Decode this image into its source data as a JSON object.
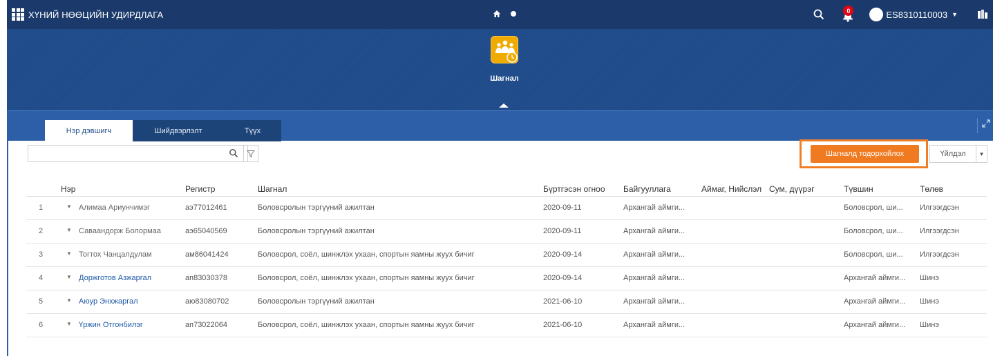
{
  "shell": {
    "title": "ХҮНИЙ НӨӨЦИЙН УДИРДЛАГА",
    "notifications_count": "0",
    "user_id": "ES8310110003",
    "user_caret": "▼"
  },
  "app": {
    "label": "Шагнал",
    "tile_color": "#f0ab00"
  },
  "tabs": [
    {
      "label": "Нэр дэвшигч"
    },
    {
      "label": "Шийдвэрлэлт"
    },
    {
      "label": "Түүх"
    }
  ],
  "toolbar": {
    "search_placeholder": "",
    "primary_label": "Шагналд тодорхойлох",
    "action_label": "Үйлдэл",
    "action_caret": "▼",
    "accent_color": "#f07a20"
  },
  "table": {
    "headers": [
      "Нэр",
      "Регистр",
      "Шагнал",
      "Бүртгэсэн огноо",
      "Байгууллага",
      "Аймаг, Нийслэл",
      "Сум, дүүрэг",
      "Түвшин",
      "Төлөв"
    ],
    "rows": [
      {
        "index": "1",
        "name": "Алимаа Ариунчимэг",
        "register": "аэ77012461",
        "award": "Боловсролын тэргүүний ажилтан",
        "date": "2020-09-11",
        "org": "Архангай аймги...",
        "aimag": "",
        "sum": "",
        "level": "Боловсрол, ши...",
        "status": "Илгээгдсэн"
      },
      {
        "index": "2",
        "name": "Саваандорж Болормаа",
        "register": "аэ65040569",
        "award": "Боловсролын тэргүүний ажилтан",
        "date": "2020-09-11",
        "org": "Архангай аймги...",
        "aimag": "",
        "sum": "",
        "level": "Боловсрол, ши...",
        "status": "Илгээгдсэн"
      },
      {
        "index": "3",
        "name": "Тогтох Чанцалдулам",
        "register": "ам86041424",
        "award": "Боловсрол, соёл, шинжлэх ухаан, спортын яамны жуух бичиг",
        "date": "2020-09-14",
        "org": "Архангай аймги...",
        "aimag": "",
        "sum": "",
        "level": "Боловсрол, ши...",
        "status": "Илгээгдсэн"
      },
      {
        "index": "4",
        "name": "Доржготов Азжаргал",
        "register": "ап83030378",
        "award": "Боловсрол, соёл, шинжлэх ухаан, спортын яамны жуух бичиг",
        "date": "2020-09-14",
        "org": "Архангай аймги...",
        "aimag": "",
        "sum": "",
        "level": "Архангай аймги...",
        "status": "Шинэ"
      },
      {
        "index": "5",
        "name": "Аюур Энхжаргал",
        "register": "аю83080702",
        "award": "Боловсролын тэргүүний ажилтан",
        "date": "2021-06-10",
        "org": "Архангай аймги...",
        "aimag": "",
        "sum": "",
        "level": "Архангай аймги...",
        "status": "Шинэ"
      },
      {
        "index": "6",
        "name": "Үржин Отгонбилэг",
        "register": "ап73022064",
        "award": "Боловсрол, соёл, шинжлэх ухаан, спортын яамны жуух бичиг",
        "date": "2021-06-10",
        "org": "Архангай аймги...",
        "aimag": "",
        "sum": "",
        "level": "Архангай аймги...",
        "status": "Шинэ"
      }
    ]
  }
}
